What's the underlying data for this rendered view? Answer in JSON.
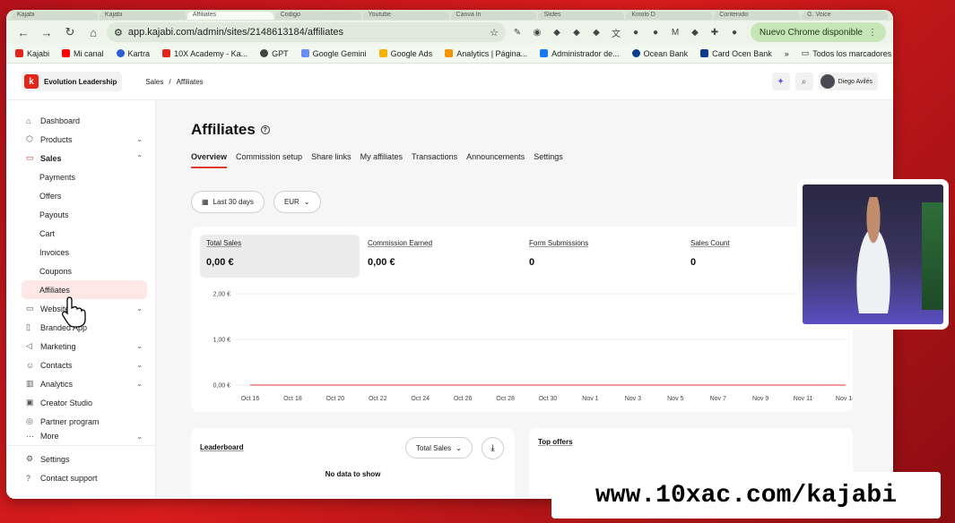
{
  "browser": {
    "tabs": [
      "Kajabi",
      "Kajabi",
      "Affiliates",
      "Codigo",
      "Youtube",
      "Canva In",
      "Slides",
      "Kinolo D",
      "Contenido",
      "G. Voice"
    ],
    "url": "app.kajabi.com/admin/sites/2148613184/affiliates",
    "update_label": "Nuevo Chrome disponible",
    "bookmarks": [
      "Kajabi",
      "Mi canal",
      "Kartra",
      "10X Academy - Ka...",
      "GPT",
      "Google Gemini",
      "Google Ads",
      "Analytics | Página...",
      "Administrador de...",
      "Ocean Bank",
      "Card Ocen Bank"
    ],
    "all_bookmarks": "Todos los marcadores"
  },
  "app": {
    "brand": "Evolution Leadership",
    "breadcrumb": {
      "parent": "Sales",
      "current": "Affiliates"
    },
    "user_name": "Diego Avilés"
  },
  "sidebar": {
    "items": [
      {
        "label": "Dashboard"
      },
      {
        "label": "Products"
      },
      {
        "label": "Sales"
      },
      {
        "label": "Payments"
      },
      {
        "label": "Offers"
      },
      {
        "label": "Payouts"
      },
      {
        "label": "Cart"
      },
      {
        "label": "Invoices"
      },
      {
        "label": "Coupons"
      },
      {
        "label": "Affiliates"
      },
      {
        "label": "Website"
      },
      {
        "label": "Branded App"
      },
      {
        "label": "Marketing"
      },
      {
        "label": "Contacts"
      },
      {
        "label": "Analytics"
      },
      {
        "label": "Creator Studio"
      },
      {
        "label": "Partner program"
      },
      {
        "label": "More"
      }
    ],
    "settings": "Settings",
    "support": "Contact support"
  },
  "page": {
    "title": "Affiliates",
    "tabs": [
      "Overview",
      "Commission setup",
      "Share links",
      "My affiliates",
      "Transactions",
      "Announcements",
      "Settings"
    ],
    "filters": {
      "range": "Last 30 days",
      "currency": "EUR"
    }
  },
  "stats": [
    {
      "label": "Total Sales",
      "value": "0,00 €"
    },
    {
      "label": "Commission Earned",
      "value": "0,00 €"
    },
    {
      "label": "Form Submissions",
      "value": "0"
    },
    {
      "label": "Sales Count",
      "value": "0"
    }
  ],
  "chart_data": {
    "type": "line",
    "x": [
      "Oct 16",
      "Oct 18",
      "Oct 20",
      "Oct 22",
      "Oct 24",
      "Oct 26",
      "Oct 28",
      "Oct 30",
      "Nov 1",
      "Nov 3",
      "Nov 5",
      "Nov 7",
      "Nov 9",
      "Nov 11",
      "Nov 14"
    ],
    "y_ticks": [
      "2,00 €",
      "1,00 €",
      "0,00 €"
    ],
    "ylim": [
      0,
      2
    ],
    "series": [
      {
        "values": [
          0,
          0,
          0,
          0,
          0,
          0,
          0,
          0,
          0,
          0,
          0,
          0,
          0,
          0,
          0
        ]
      }
    ],
    "title": "",
    "xlabel": "",
    "ylabel": ""
  },
  "leaderboard": {
    "title": "Leaderboard",
    "sort_label": "Total Sales",
    "empty_title": "No data to show"
  },
  "top_offers": {
    "title": "Top offers"
  },
  "overlay_url": "www.10xac.com/kajabi"
}
